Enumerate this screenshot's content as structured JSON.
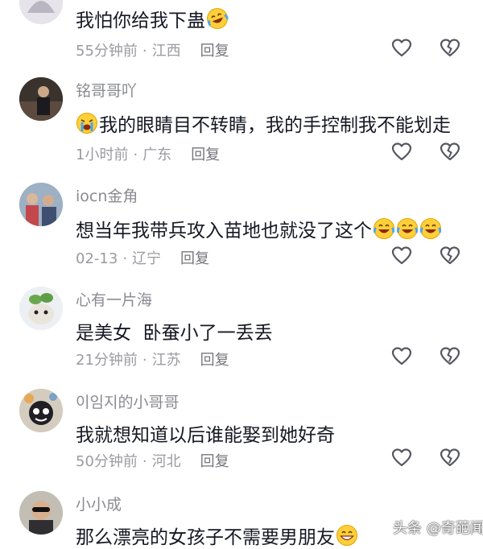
{
  "comments": [
    {
      "username": "",
      "text": "我怕你给我下蛊",
      "time": "55分钟前",
      "location": "江西",
      "reply_label": "回复"
    },
    {
      "username": "铭哥哥吖",
      "text": "我的眼睛目不转睛，我的手控制我不能划走",
      "time": "1小时前",
      "location": "广东",
      "reply_label": "回复"
    },
    {
      "username": "iocn金角",
      "text": "想当年我带兵攻入苗地也就没了这个",
      "time": "02-13",
      "location": "辽宁",
      "reply_label": "回复"
    },
    {
      "username": "心有一片海",
      "text": "是美女  卧蚕小了一丢丢",
      "time": "21分钟前",
      "location": "江苏",
      "reply_label": "回复"
    },
    {
      "username": "이임지的小哥哥",
      "text": "我就想知道以后谁能娶到她好奇",
      "time": "50分钟前",
      "location": "河北",
      "reply_label": "回复"
    },
    {
      "username": "小小成",
      "text": "那么漂亮的女孩子不需要男朋友",
      "time": "",
      "location": "",
      "reply_label": ""
    }
  ],
  "separator": "·",
  "icons": {
    "like": "heart-outline-icon",
    "dislike": "broken-heart-icon",
    "emoji_cry_laugh": "laughing-crying-emoji",
    "emoji_crying": "crying-emoji",
    "emoji_grin": "grinning-emoji"
  },
  "watermark": "头条 @奇葩闻"
}
